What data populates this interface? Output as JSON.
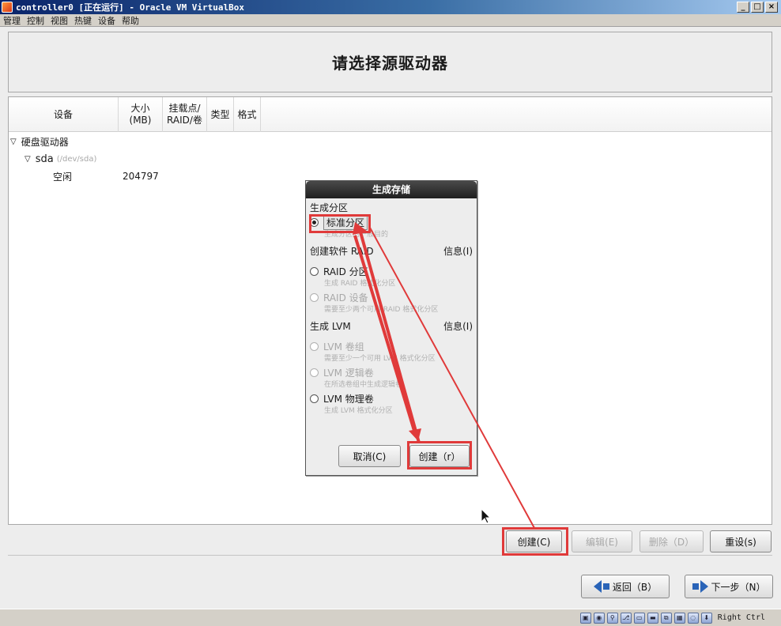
{
  "window": {
    "title": "controller0 [正在运行] - Oracle VM VirtualBox",
    "minimize": "_",
    "maximize": "□",
    "close": "×"
  },
  "menu": [
    "管理",
    "控制",
    "视图",
    "热键",
    "设备",
    "帮助"
  ],
  "header": {
    "title": "请选择源驱动器"
  },
  "table": {
    "columns": [
      {
        "label": "设备"
      },
      {
        "label": "大小\n(MB)"
      },
      {
        "label": "挂载点/\nRAID/卷"
      },
      {
        "label": "类型"
      },
      {
        "label": "格式"
      }
    ],
    "tree": {
      "group": "硬盘驱动器",
      "disk": "sda",
      "disk_path": "(/dev/sda)",
      "free_label": "空闲",
      "free_size": "204797"
    }
  },
  "dialog": {
    "title": "生成存储",
    "section_partition": "生成分区",
    "std_partition": "标准分区",
    "std_partition_hint": "生成分区的一般目的",
    "section_raid": "创建软件 RAID",
    "info_label": "信息(I)",
    "raid_partition": "RAID 分区",
    "raid_partition_hint": "生成 RAID 格式化分区",
    "raid_device": "RAID 设备",
    "raid_device_hint": "需要至少两个可用 RAID 格式化分区",
    "section_lvm": "生成 LVM",
    "lvm_info_label": "信息(I)",
    "lvm_vg": "LVM 卷组",
    "lvm_vg_hint": "需要至少一个可用 LVM 格式化分区",
    "lvm_lv": "LVM 逻辑卷",
    "lvm_lv_hint": "在所选卷组中生成逻辑卷",
    "lvm_pv": "LVM 物理卷",
    "lvm_pv_hint": "生成 LVM 格式化分区",
    "cancel": "取消(C)",
    "create": "创建（r）",
    "selected_option": "std_partition"
  },
  "actions": {
    "create": "创建(C)",
    "edit": "编辑(E)",
    "delete": "删除（D）",
    "reset": "重设(s)"
  },
  "nav": {
    "back": "返回（B）",
    "next": "下一步（N）"
  },
  "status": {
    "host_key": "Right Ctrl"
  },
  "colors": {
    "annotation_red": "#e03a3a",
    "titlebar": "#0a246a",
    "nav_arrow": "#2a64b8"
  }
}
